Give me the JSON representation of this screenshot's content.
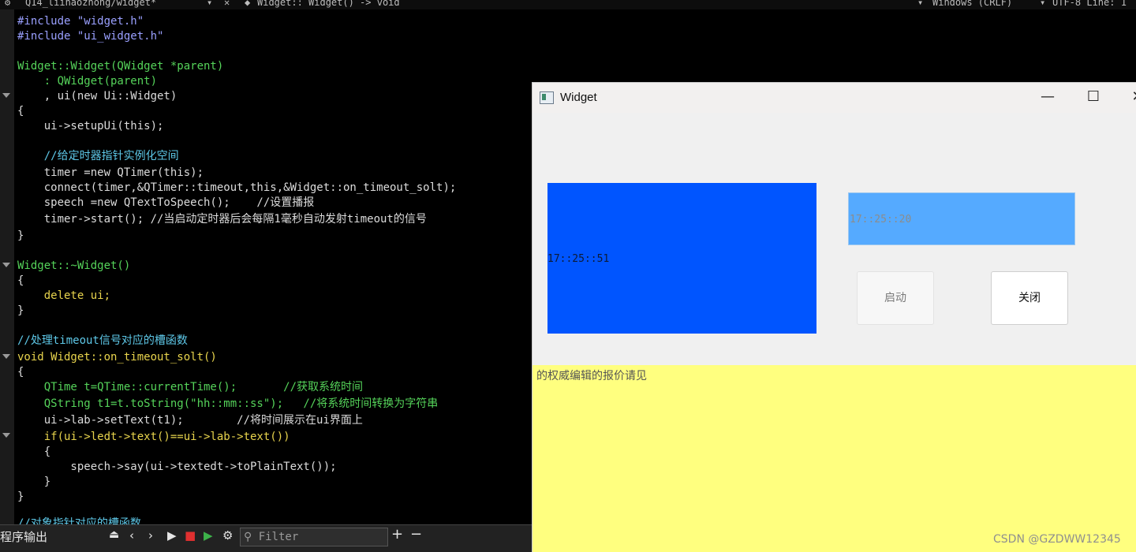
{
  "toolbar": {
    "file": "Q14_liinaozhong/widget*",
    "symbol": "Widget:: Widget() -> void",
    "encoding": "Windows (CRLF)",
    "line_info": "UTF-8 Line: 1"
  },
  "editor": {
    "lines": [
      "#include \"widget.h\"",
      "#include \"ui_widget.h\"",
      "Widget::Widget(QWidget *parent)",
      "    : QWidget(parent)",
      "    , ui(new Ui::Widget)",
      "{",
      "    ui->setupUi(this);",
      "    //给定时器指针实例化空间",
      "    timer =new QTimer(this);",
      "    connect(timer,&QTimer::timeout,this,&Widget::on_timeout_solt);",
      "    speech =new QTextToSpeech();    //设置播报",
      "    timer->start(); //当启动定时器后会每隔1毫秒自动发射timeout的信号",
      "}",
      "Widget::~Widget()",
      "{",
      "    delete ui;",
      "}",
      "//处理timeout信号对应的槽函数",
      "void Widget::on_timeout_solt()",
      "{",
      "    QTime t=QTime::currentTime();       //获取系统时间",
      "    QString t1=t.toString(\"hh::mm::ss\");   //将系统时间转换为字符串",
      "    ui->lab->setText(t1);        //将时间展示在ui界面上",
      "    if(ui->ledt->text()==ui->lab->text())",
      "    {",
      "        speech->say(ui->textedt->toPlainText());",
      "    }",
      "}",
      "//对象指针对应的槽函数"
    ]
  },
  "bottom": {
    "panel_label": "程序输出",
    "filter_placeholder": "Filter",
    "add": "+",
    "remove": "−"
  },
  "window": {
    "title": "Widget",
    "minimize": "—",
    "maximize": "☐",
    "close": "✕",
    "label_time": "17::25::51",
    "ledt_time": "17::25::20",
    "start_button": "启动",
    "close_button": "关闭",
    "text_content": "的权威编辑的报价请见"
  },
  "watermark": "CSDN @GZDWW12345",
  "colors": {
    "label_bg": "#0055ff",
    "ledt_bg": "#55aaff",
    "textedit_bg": "#ffff7f"
  }
}
